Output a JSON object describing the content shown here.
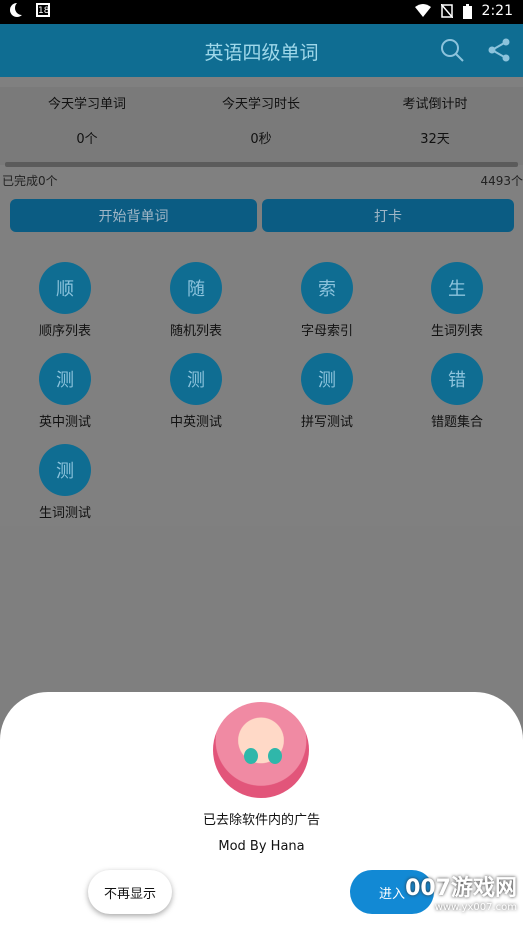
{
  "status_bar": {
    "time": "2:21",
    "calendar_day": "18",
    "icons": [
      "moon-icon",
      "calendar-icon",
      "wifi-icon",
      "no-sim-icon",
      "battery-icon"
    ]
  },
  "app_bar": {
    "title": "英语四级单词",
    "icons": [
      "search-icon",
      "share-icon"
    ]
  },
  "stats": {
    "today_words_label": "今天学习单词",
    "today_words_value": "0个",
    "today_time_label": "今天学习时长",
    "today_time_value": "0秒",
    "countdown_label": "考试倒计时",
    "countdown_value": "32天"
  },
  "progress": {
    "completed_text": "已完成0个",
    "total_text": "4493个"
  },
  "buttons": {
    "start": "开始背单词",
    "checkin": "打卡"
  },
  "grid": [
    {
      "icon": "顺",
      "label": "顺序列表"
    },
    {
      "icon": "随",
      "label": "随机列表"
    },
    {
      "icon": "索",
      "label": "字母索引"
    },
    {
      "icon": "生",
      "label": "生词列表"
    },
    {
      "icon": "测",
      "label": "英中测试"
    },
    {
      "icon": "测",
      "label": "中英测试"
    },
    {
      "icon": "测",
      "label": "拼写测试"
    },
    {
      "icon": "错",
      "label": "错题集合"
    },
    {
      "icon": "测",
      "label": "生词测试"
    }
  ],
  "sheet": {
    "notice": "已去除软件内的广告",
    "mod": "Mod By Hana",
    "dont_show": "不再显示",
    "enter": "进入"
  },
  "watermark": {
    "main": "007游戏网",
    "url": "www.yx007.com"
  },
  "colors": {
    "primary": "#0f6d92",
    "accent": "#1289d4"
  }
}
